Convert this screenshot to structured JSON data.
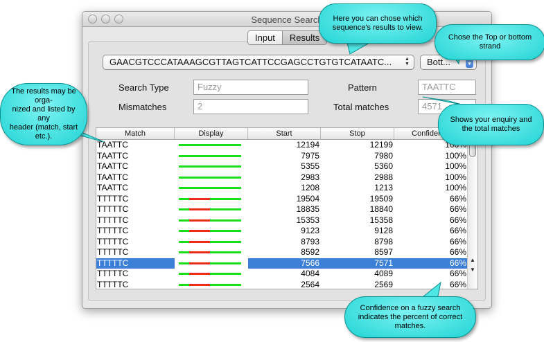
{
  "window": {
    "title": "Sequence Search"
  },
  "tabs": [
    {
      "label": "Input",
      "active": false
    },
    {
      "label": "Results",
      "active": true
    }
  ],
  "sequence_popup": {
    "value": "GAACGTCCCATAAAGCGTTAGTCATTCCGAGCCTGTGTCATAATC..."
  },
  "strand_popup": {
    "value": "Bott..."
  },
  "form": {
    "search_type_label": "Search Type",
    "search_type_value": "Fuzzy",
    "mismatches_label": "Mismatches",
    "mismatches_value": "2",
    "pattern_label": "Pattern",
    "pattern_value": "TAATTC",
    "total_matches_label": "Total matches",
    "total_matches_value": "4571"
  },
  "table": {
    "columns": [
      "Match",
      "Display",
      "Start",
      "Stop",
      "Confidence"
    ],
    "rows": [
      {
        "match": "TAATTC",
        "start": "12194",
        "stop": "12199",
        "confidence": "100%",
        "fuzzy": false,
        "selected": false
      },
      {
        "match": "TAATTC",
        "start": "7975",
        "stop": "7980",
        "confidence": "100%",
        "fuzzy": false,
        "selected": false
      },
      {
        "match": "TAATTC",
        "start": "5355",
        "stop": "5360",
        "confidence": "100%",
        "fuzzy": false,
        "selected": false
      },
      {
        "match": "TAATTC",
        "start": "2983",
        "stop": "2988",
        "confidence": "100%",
        "fuzzy": false,
        "selected": false
      },
      {
        "match": "TAATTC",
        "start": "1208",
        "stop": "1213",
        "confidence": "100%",
        "fuzzy": false,
        "selected": false
      },
      {
        "match": "TTTTTC",
        "start": "19504",
        "stop": "19509",
        "confidence": "66%",
        "fuzzy": true,
        "selected": false
      },
      {
        "match": "TTTTTC",
        "start": "18835",
        "stop": "18840",
        "confidence": "66%",
        "fuzzy": true,
        "selected": false
      },
      {
        "match": "TTTTTC",
        "start": "15353",
        "stop": "15358",
        "confidence": "66%",
        "fuzzy": true,
        "selected": false
      },
      {
        "match": "TTTTTC",
        "start": "9123",
        "stop": "9128",
        "confidence": "66%",
        "fuzzy": true,
        "selected": false
      },
      {
        "match": "TTTTTC",
        "start": "8793",
        "stop": "8798",
        "confidence": "66%",
        "fuzzy": true,
        "selected": false
      },
      {
        "match": "TTTTTC",
        "start": "8592",
        "stop": "8597",
        "confidence": "66%",
        "fuzzy": true,
        "selected": false
      },
      {
        "match": "TTTTTC",
        "start": "7566",
        "stop": "7571",
        "confidence": "66%",
        "fuzzy": true,
        "selected": true
      },
      {
        "match": "TTTTTC",
        "start": "4084",
        "stop": "4089",
        "confidence": "66%",
        "fuzzy": true,
        "selected": false
      },
      {
        "match": "TTTTTC",
        "start": "2564",
        "stop": "2569",
        "confidence": "66%",
        "fuzzy": true,
        "selected": false
      }
    ]
  },
  "callouts": {
    "results_view": [
      "Here you can chose which",
      "sequence's results to view."
    ],
    "strand": [
      "Chose the Top or bottom",
      "strand"
    ],
    "header_sort": [
      "The results may be orga-",
      "nized and listed by any",
      "header (match, start etc.)."
    ],
    "enquiry": [
      "Shows your enquiry and",
      "the total matches"
    ],
    "confidence": [
      "Confidence on a fuzzy search",
      "indicates the percent of correct",
      "matches."
    ]
  },
  "colors": {
    "callout_fill": "#3fe0e0",
    "selection": "#3b7fd6",
    "bar_match": "#19e01a",
    "bar_mismatch": "#ee2a1a"
  }
}
